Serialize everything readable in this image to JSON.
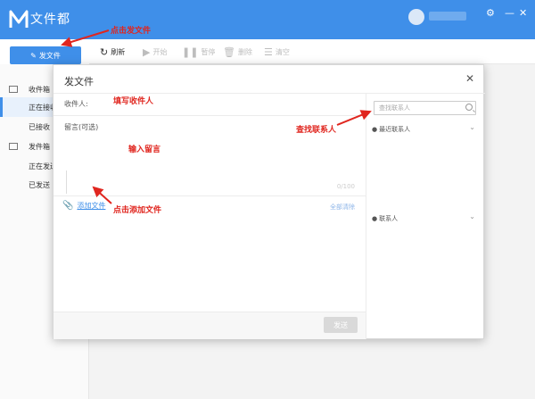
{
  "app": {
    "title": "文件都",
    "user_name": ""
  },
  "window": {
    "settings_icon": "gear-icon",
    "minimize": "—",
    "close": "✕"
  },
  "send_button": {
    "label": "发文件"
  },
  "toolbar": {
    "items": [
      {
        "label": "刷新",
        "icon": "refresh-icon",
        "enabled": true
      },
      {
        "label": "开始",
        "icon": "play-icon",
        "enabled": false
      },
      {
        "label": "暂停",
        "icon": "pause-icon",
        "enabled": false
      },
      {
        "label": "删除",
        "icon": "trash-icon",
        "enabled": false
      },
      {
        "label": "清空",
        "icon": "list-icon",
        "enabled": false
      }
    ]
  },
  "sidebar": {
    "items": [
      {
        "label": "收件箱",
        "group": true
      },
      {
        "label": "正在接收",
        "active": true
      },
      {
        "label": "已接收"
      },
      {
        "label": "发件箱",
        "group": true
      },
      {
        "label": "正在发送"
      },
      {
        "label": "已发送"
      }
    ]
  },
  "dialog": {
    "title": "发文件",
    "recipient_label": "收件人:",
    "message_label": "留言(可选)",
    "message_count": "0/100",
    "attach_label": "添加文件",
    "attach_right": "全部清除",
    "ok_label": "发送",
    "search_placeholder": "查找联系人",
    "groups": [
      {
        "label": "最近联系人"
      },
      {
        "label": "联系人"
      }
    ]
  },
  "annotations": {
    "click_send": "点击发文件",
    "fill_recipient": "填写收件人",
    "find_contact": "查找联系人",
    "input_message": "输入留言",
    "click_add": "点击添加文件"
  },
  "colors": {
    "brand": "#3f8fe9",
    "annotation": "#e0261f"
  }
}
